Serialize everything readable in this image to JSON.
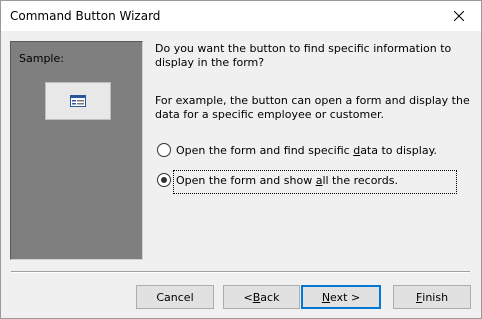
{
  "window": {
    "title": "Command Button Wizard",
    "close_icon": "close-icon"
  },
  "sample": {
    "label": "Sample:",
    "preview_icon": "form-icon"
  },
  "question": {
    "text": "Do you want the button to find specific information to display in the form?"
  },
  "example": {
    "text": "For example, the button can open a form and display the data for a specific employee or customer."
  },
  "options": [
    {
      "label_pre": "Open the form and find specific ",
      "label_key": "d",
      "label_post": "ata to display.",
      "selected": false
    },
    {
      "label_pre": "Open the form and show ",
      "label_key": "a",
      "label_post": "ll the records.",
      "selected": true
    }
  ],
  "buttons": {
    "cancel": "Cancel",
    "back_pre": "< ",
    "back_key": "B",
    "back_post": "ack",
    "next_key": "N",
    "next_post": "ext >",
    "finish_key": "F",
    "finish_post": "inish"
  },
  "colors": {
    "sample_panel": "#7f7f7f",
    "focus_border": "#0078d7"
  }
}
